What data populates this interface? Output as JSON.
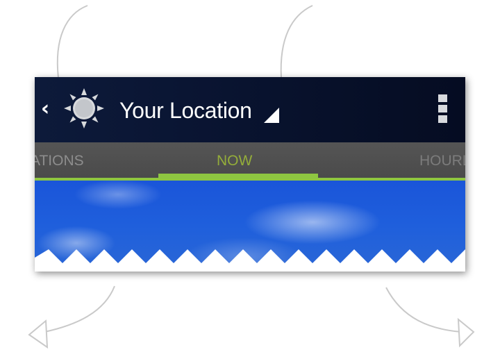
{
  "action_bar": {
    "title": "Your Location",
    "back_icon": "chevron-left-icon",
    "app_icon": "sun-icon",
    "spinner_icon": "dropdown-triangle-icon",
    "menu_icon": "overflow-menu-icon"
  },
  "tabs": [
    {
      "label": "ATIONS",
      "active": false
    },
    {
      "label": "NOW",
      "active": true
    },
    {
      "label": "HOURL",
      "active": false
    }
  ],
  "colors": {
    "action_bar": "#0a1533",
    "tab_strip": "#4f4f4f",
    "tab_active_text": "#94ad3a",
    "tab_indicator": "#8ec641",
    "sky": "#1f5fdc"
  }
}
